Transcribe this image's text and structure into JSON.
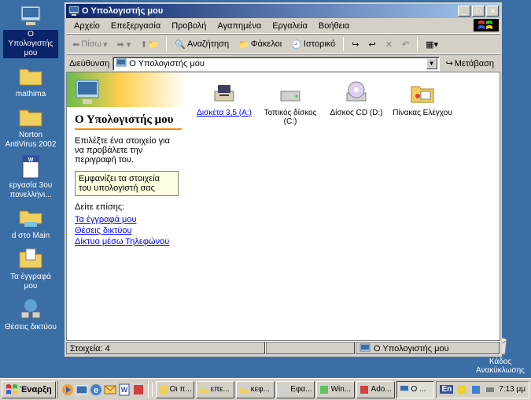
{
  "desktop_icons": [
    {
      "name": "my-computer",
      "label": "Ο Υπολογιστής μου"
    },
    {
      "name": "folder-mathima",
      "label": "mathima"
    },
    {
      "name": "folder-norton",
      "label": "Norton AntiVirus 2002"
    },
    {
      "name": "word-doc",
      "label": "εργασία 3ου πανελλήνι..."
    },
    {
      "name": "folder-d-main",
      "label": "d στο Main"
    },
    {
      "name": "my-documents",
      "label": "Τα έγγραφά μου"
    },
    {
      "name": "network-places",
      "label": "Θέσεις δικτύου"
    }
  ],
  "recycle_label": "Κάδος Ανακύκλωσης",
  "window": {
    "title": "Ο Υπολογιστής μου",
    "menus": [
      "Αρχείο",
      "Επεξεργασία",
      "Προβολή",
      "Αγαπημένα",
      "Εργαλεία",
      "Βοήθεια"
    ],
    "toolbar": {
      "back": "Πίσω",
      "search": "Αναζήτηση",
      "folders": "Φάκελοι",
      "history": "Ιστορικό"
    },
    "address_label": "Διεύθυνση",
    "address_value": "Ο Υπολογιστής μου",
    "go_label": "Μετάβαση",
    "panel": {
      "heading": "Ο Υπολογιστής μου",
      "desc": "Επιλέξτε ένα στοιχείο για να προβάλετε την περιγραφή του.",
      "info": "Εμφανίζει τα στοιχεία του υπολογιστή σας",
      "see_also": "Δείτε επίσης:",
      "links": [
        "Τα έγγραφά μου",
        "Θέσεις δικτύου",
        "Δίκτυο μέσω Τηλεφώνου"
      ]
    },
    "items": [
      {
        "label": "Δισκέτα 3,5 (A:)",
        "selected": true
      },
      {
        "label": "Τοπικός δίσκος (C:)"
      },
      {
        "label": "Δίσκος CD (D:)"
      },
      {
        "label": "Πίνακας Ελέγχου"
      }
    ],
    "status_count": "Στοιχεία: 4",
    "status_loc": "Ο Υπολογιστής μου"
  },
  "taskbar": {
    "start": "Έναρξη",
    "tasks": [
      {
        "label": "Οι π..."
      },
      {
        "label": "επε..."
      },
      {
        "label": "κεφ..."
      },
      {
        "label": "Εφα..."
      },
      {
        "label": "Win..."
      },
      {
        "label": "Ado..."
      },
      {
        "label": "Ο ...",
        "active": true
      }
    ],
    "lang": "En",
    "time": "7:13 μμ"
  }
}
